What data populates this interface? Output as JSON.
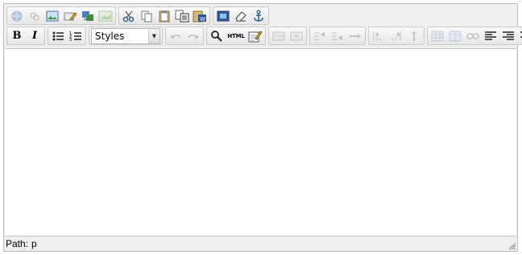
{
  "toolbar": {
    "style_select": {
      "selected": "Styles"
    },
    "bold_label": "B",
    "italic_label": "I",
    "html_label": "HTML"
  },
  "statusbar": {
    "path_label": "Path:",
    "path_value": "p"
  },
  "colors": {
    "frame_border": "#b7b7b7",
    "toolbar_bg": "#f0f0ee",
    "edit_bg": "#ffffff"
  }
}
